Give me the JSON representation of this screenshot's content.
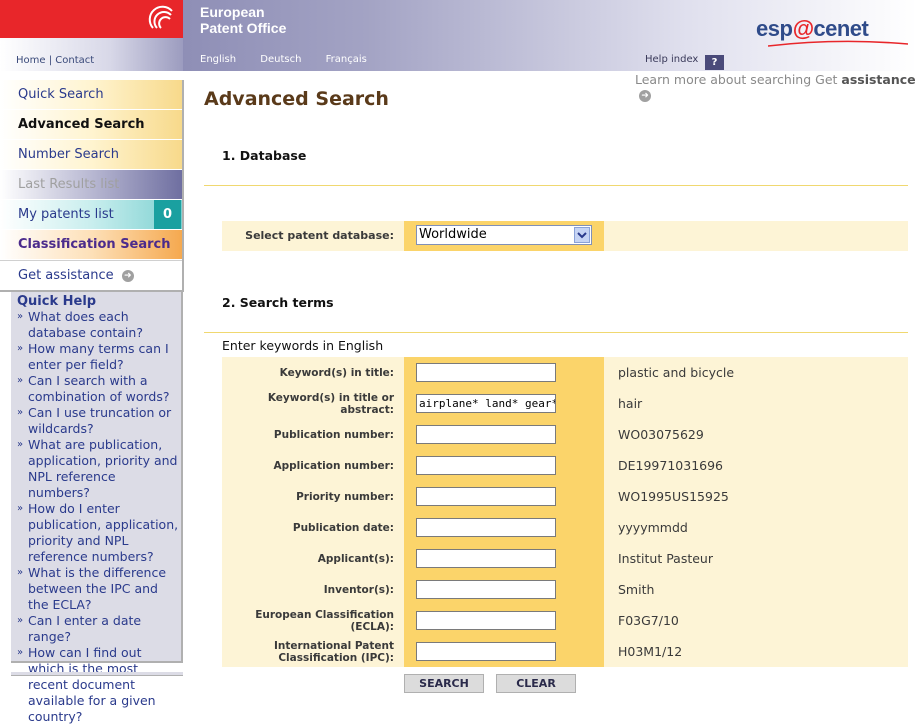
{
  "header": {
    "org_line1": "European",
    "org_line2": "Patent Office",
    "logo_prefix": "esp",
    "logo_a": "@",
    "logo_suffix": "cenet",
    "home": "Home",
    "sep": "|",
    "contact": "Contact",
    "languages": [
      "English",
      "Deutsch",
      "Français"
    ],
    "help_index": "Help index",
    "help_q": "?"
  },
  "sidebar": {
    "items": [
      {
        "label": "Quick Search"
      },
      {
        "label": "Advanced Search"
      },
      {
        "label": "Number Search"
      },
      {
        "label": "Last Results list"
      },
      {
        "label": "My patents list",
        "badge": "0"
      },
      {
        "label": "Classification Search"
      },
      {
        "label": "Get assistance"
      }
    ]
  },
  "quick_help": {
    "title": "Quick Help",
    "items": [
      "What does each database contain?",
      "How many terms can I enter per field?",
      "Can I search with a combination of words?",
      "Can I use truncation or wildcards?",
      "What are publication, application, priority and NPL reference numbers?",
      "How do I enter publication, application, priority and NPL reference numbers?",
      "What is the difference between the IPC and the ECLA?",
      "Can I enter a date range?",
      "How can I find out which is the most recent document available for a given country?"
    ]
  },
  "main": {
    "learn_more_prefix": "Learn more about searching Get",
    "learn_more_link": "assistance",
    "title": "Advanced Search",
    "section1": "1. Database",
    "db_label": "Select patent database:",
    "db_value": "Worldwide",
    "section2": "2. Search terms",
    "enter_keywords": "Enter keywords in English",
    "fields": [
      {
        "label": "Keyword(s) in title:",
        "value": "",
        "example": "plastic and bicycle"
      },
      {
        "label": "Keyword(s) in title or abstract:",
        "value": "airplane* land* gear* rc",
        "example": "hair"
      },
      {
        "label": "Publication number:",
        "value": "",
        "example": "WO03075629"
      },
      {
        "label": "Application number:",
        "value": "",
        "example": "DE19971031696"
      },
      {
        "label": "Priority number:",
        "value": "",
        "example": "WO1995US15925"
      },
      {
        "label": "Publication date:",
        "value": "",
        "example": "yyyymmdd"
      },
      {
        "label": "Applicant(s):",
        "value": "",
        "example": "Institut Pasteur"
      },
      {
        "label": "Inventor(s):",
        "value": "",
        "example": "Smith"
      },
      {
        "label": "European Classification (ECLA):",
        "value": "",
        "example": "F03G7/10"
      },
      {
        "label": "International Patent Classification (IPC):",
        "value": "",
        "example": "H03M1/12"
      }
    ],
    "search_button": "SEARCH",
    "clear_button": "CLEAR"
  },
  "colors": {
    "epo_red": "#e8262a",
    "field_cell": "#fbd46a",
    "row_bg": "#fdf4d6",
    "nav_text": "#2a3a8c"
  }
}
